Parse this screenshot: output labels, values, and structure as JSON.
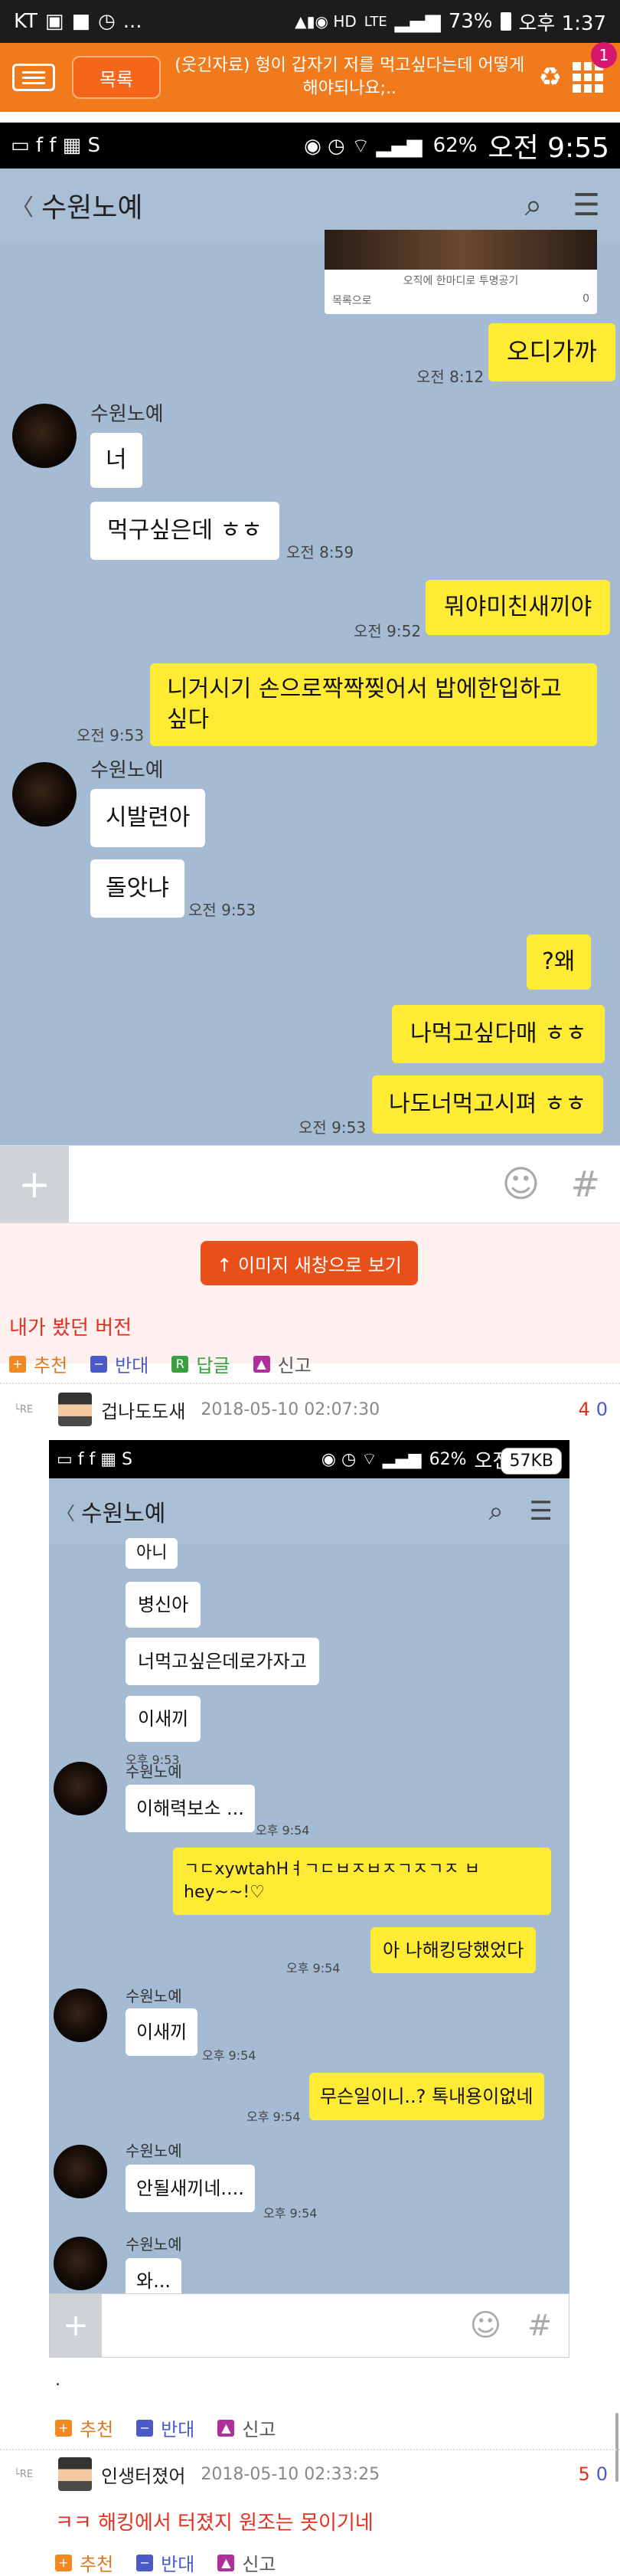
{
  "status_bar": {
    "carrier": "KT",
    "battery": "73%",
    "time": "오후 1:37",
    "net": "LTE"
  },
  "app_header": {
    "list_button": "목록",
    "title": "(웃긴자료) 형이 갑자기 저를 먹고싶다는데 어떻게 해야되나요;..",
    "badge": "1"
  },
  "chat1": {
    "status": {
      "battery": "62%",
      "time": "오전 9:55"
    },
    "title": "수원노예",
    "preview": {
      "caption": "오직에 한마디로 투명공기",
      "footer": "목록으로",
      "count": "0"
    },
    "messages": [
      {
        "text": "오디가까",
        "time": "오전 8:12"
      },
      {
        "sender": "수원노예",
        "text": "너"
      },
      {
        "text": "먹구싶은데 ㅎㅎ",
        "time": "오전 8:59"
      },
      {
        "text": "뭐야미친새끼야",
        "time": "오전 9:52"
      },
      {
        "text": "니거시기 손으로짝짝찢어서 밥에한입하고싶다",
        "time": "오전 9:53"
      },
      {
        "sender": "수원노예",
        "text": "시발련아"
      },
      {
        "text": "돌앗냐",
        "time": "오전 9:53"
      },
      {
        "text": "?왜"
      },
      {
        "text": "나먹고싶다매 ㅎㅎ"
      },
      {
        "text": "나도너먹고시펴 ㅎㅎ",
        "time": "오전 9:53"
      }
    ]
  },
  "view_image_button": "↑ 이미지 새창으로 보기",
  "post_text": "내가 봤던 버전",
  "actions": {
    "recommend": "추천",
    "oppose": "반대",
    "reply": "답글",
    "report": "신고"
  },
  "comment1": {
    "re": "└RE",
    "author": "겁나도도새",
    "date": "2018-05-10 02:07:30",
    "up": "4",
    "down": "0"
  },
  "chat2": {
    "status": {
      "battery": "62%",
      "time": "오전 9:55"
    },
    "title": "수원노예",
    "size_badge": "57KB",
    "messages": [
      {
        "text": "아니"
      },
      {
        "text": "병신아"
      },
      {
        "text": "너먹고싶은데로가자고"
      },
      {
        "text": "이새끼",
        "time": "오후 9:53"
      },
      {
        "sender": "수원노예",
        "text": "이해력보소 ...",
        "time": "오후 9:54"
      },
      {
        "text": "ㄱㄷxywtahHㅕㄱㄷㅂㅈㅂㅈㄱㅈㄱㅈ ㅂhey~~!♡"
      },
      {
        "text": "아 나해킹당했었다",
        "time": "오후 9:54"
      },
      {
        "sender": "수원노예",
        "text": "이새끼",
        "time": "오후 9:54"
      },
      {
        "text": "무슨일이니..? 톡내용이없네",
        "time": "오후 9:54"
      },
      {
        "sender": "수원노예",
        "text": "안될새끼네....",
        "time": "오후 9:54"
      },
      {
        "sender": "수원노예",
        "text": "와..."
      }
    ]
  },
  "dot_text": ".",
  "comment2": {
    "re": "└RE",
    "author": "인생터졌어",
    "date": "2018-05-10 02:33:25",
    "up": "5",
    "down": "0",
    "text": "ㅋㅋ 해킹에서 터졌지 원조는 못이기네"
  },
  "colors": {
    "orange": "#f07a1c",
    "kakao_bg": "#a5bbd3",
    "kakao_yellow": "#ffeb33",
    "red": "#e03020"
  }
}
